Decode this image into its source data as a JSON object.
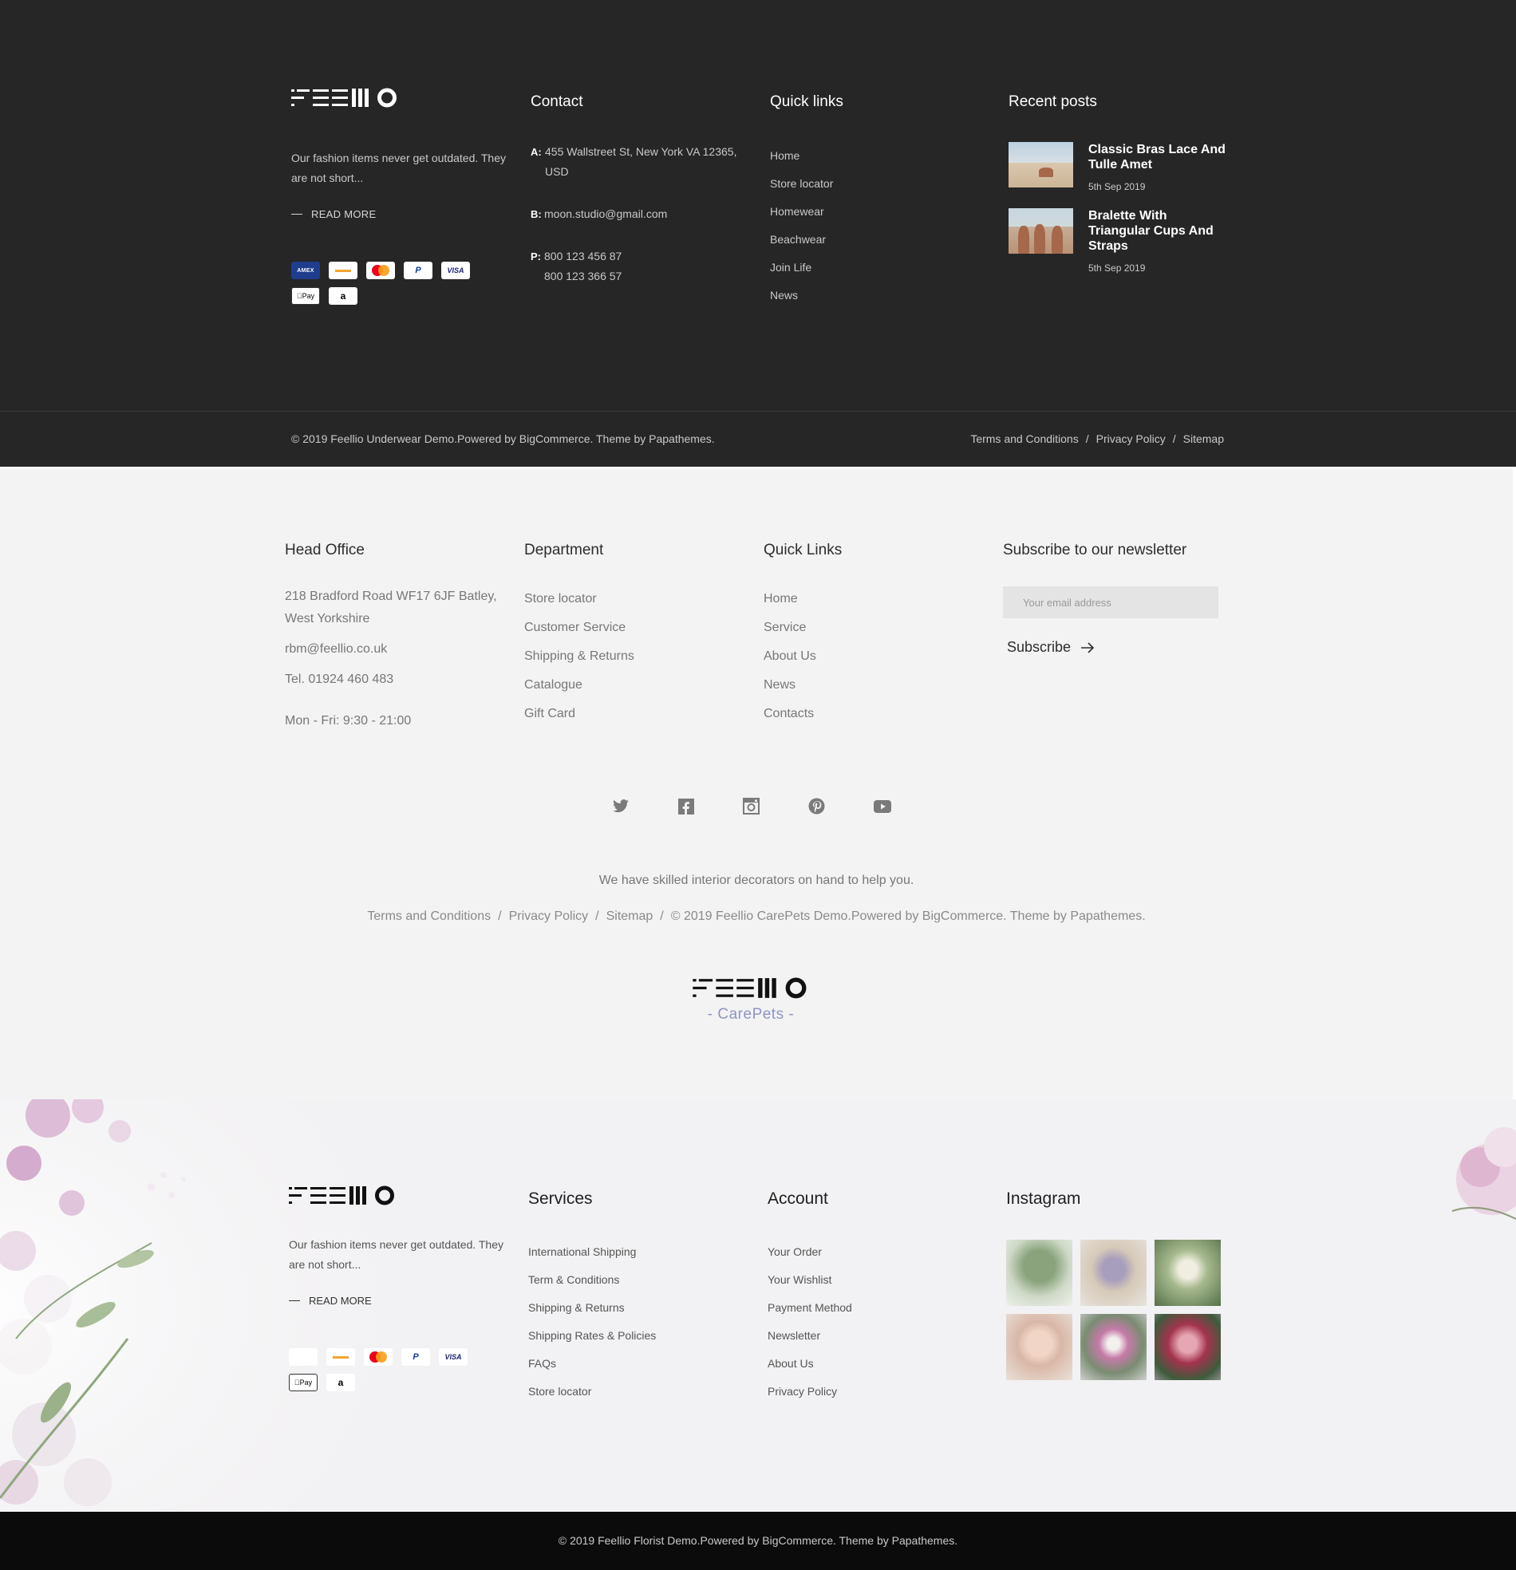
{
  "dark": {
    "about": "Our fashion items never get outdated. They are not short...",
    "read_more": "READ MORE",
    "contact_title": "Contact",
    "contact": [
      {
        "key": "A:",
        "value": "455 Wallstreet St, New York VA 12365, USD"
      },
      {
        "key": "B:",
        "value": "moon.studio@gmail.com"
      },
      {
        "key": "P:",
        "value": "800 123 456 87\n800 123 366 57"
      }
    ],
    "quick_title": "Quick links",
    "quick_links": [
      "Home",
      "Store locator",
      "Homewear",
      "Beachwear",
      "Join Life",
      "News"
    ],
    "posts_title": "Recent posts",
    "posts": [
      {
        "title": "Classic Bras Lace And Tulle Amet",
        "date": "5th Sep 2019"
      },
      {
        "title": "Bralette With Triangular Cups And Straps",
        "date": "5th Sep 2019"
      }
    ],
    "payments": [
      "AMEX",
      "",
      "",
      "P",
      "VISA",
      "Pay",
      "a"
    ],
    "copyright": "© 2019 Feellio Underwear Demo.Powered by BigCommerce. Theme by Papathemes.",
    "bottom_links": [
      "Terms and Conditions",
      "Privacy Policy",
      "Sitemap"
    ]
  },
  "light": {
    "head_title": "Head Office",
    "address": "218 Bradford Road WF17 6JF Batley, West Yorkshire",
    "email": "rbm@feellio.co.uk",
    "tel": "Tel. 01924 460 483",
    "hours": "Mon - Fri: 9:30 - 21:00",
    "dept_title": "Department",
    "departments": [
      "Store locator",
      "Customer Service",
      "Shipping & Returns",
      "Catalogue",
      "Gift Card"
    ],
    "quick_title": "Quick Links",
    "quick_links": [
      "Home",
      "Service",
      "About Us",
      "News",
      "Contacts"
    ],
    "newsletter_title": "Subscribe to our newsletter",
    "email_placeholder": "Your email address",
    "subscribe_label": "Subscribe",
    "social_icons": [
      "twitter-icon",
      "facebook-icon",
      "instagram-icon",
      "pinterest-icon",
      "youtube-icon"
    ],
    "help_text": "We have skilled interior decorators on hand to help you.",
    "legal_links": [
      "Terms and Conditions",
      "Privacy Policy",
      "Sitemap"
    ],
    "legal_copyright": "© 2019 Feellio CarePets Demo.Powered by BigCommerce. Theme by Papathemes.",
    "logo_sub": "- CarePets -"
  },
  "florist": {
    "about": "Our fashion items never get outdated. They are not short...",
    "read_more": "READ MORE",
    "services_title": "Services",
    "services": [
      "International Shipping",
      "Term & Conditions",
      "Shipping & Returns",
      "Shipping Rates & Policies",
      "FAQs",
      "Store locator"
    ],
    "account_title": "Account",
    "account": [
      "Your Order",
      "Your Wishlist",
      "Payment Method",
      "Newsletter",
      "About Us",
      "Privacy Policy"
    ],
    "instagram_title": "Instagram",
    "copyright": "© 2019 Feellio Florist Demo.Powered by BigCommerce. Theme by Papathemes."
  },
  "colors": {
    "dark_bg": "#262626",
    "light_bg": "#f3f3f3",
    "florist_bg": "#f2f1f3",
    "accent_purple": "#8e94c4"
  }
}
